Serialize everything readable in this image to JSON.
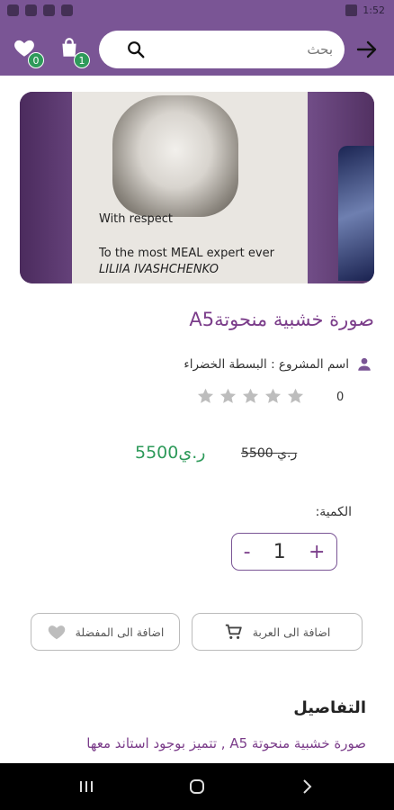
{
  "status_bar": {
    "time": "1:52"
  },
  "header": {
    "search_placeholder": "بحث",
    "favorites_count": "0",
    "cart_count": "1"
  },
  "hero_image": {
    "line1": "With respect",
    "line2": "To the most MEAL expert ever",
    "line3": "LILIIA IVASHCHENKO"
  },
  "product": {
    "title": "صورة خشبية منحوتةA5",
    "project": "اسم المشروع : البسطة الخضراء",
    "rating_count": "0",
    "price_new": "5500ر.ي",
    "price_old": "5500 ر.ي",
    "quantity_label": "الكمية:",
    "quantity": "1"
  },
  "actions": {
    "add_to_cart": "اضافة الى العربة",
    "add_to_favorites": "اضافة الى المفضلة"
  },
  "details": {
    "heading": "التفاصيل",
    "text": "صورة خشبية منحوتة A5 , تتميز بوجود استاند معها"
  },
  "colors": {
    "primary": "#7a5595",
    "accent": "#2e9a5a",
    "title": "#7b3d8a"
  }
}
